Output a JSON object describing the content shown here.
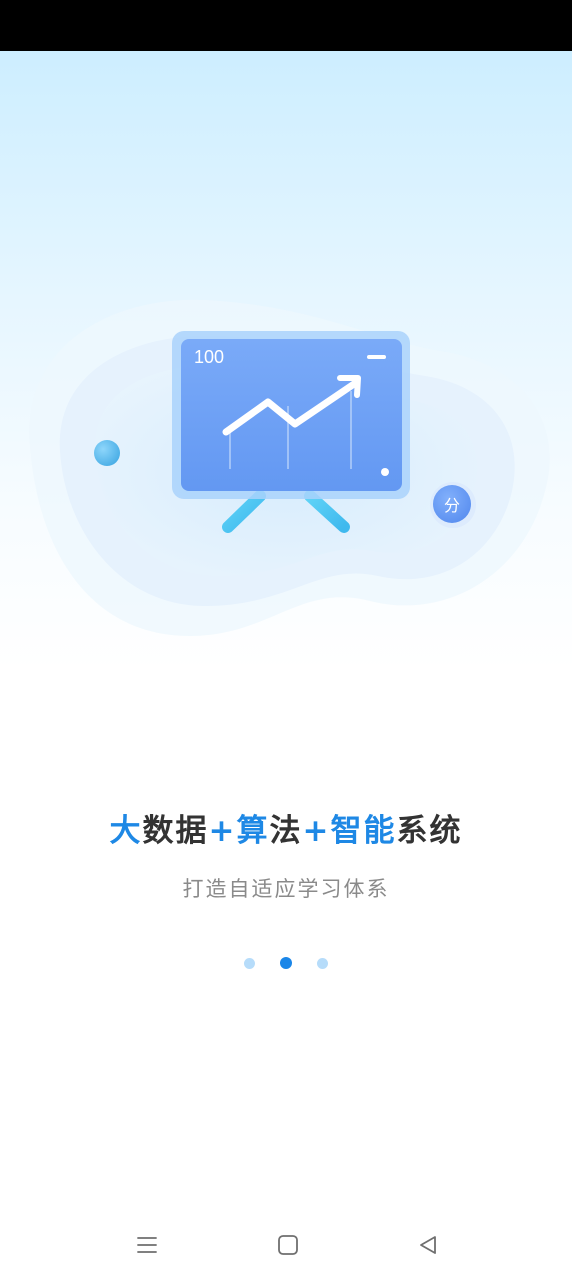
{
  "illustration": {
    "board_value": "100",
    "badge": "分"
  },
  "headline": {
    "part1": "大",
    "part2": "数据",
    "part3": "+算",
    "part4": "法",
    "part5": "+智能",
    "part6": "系统"
  },
  "subtitle": "打造自适应学习体系",
  "pagination": {
    "total": 3,
    "active_index": 1
  },
  "nav_bar": {
    "menu_icon": "menu-icon",
    "home_icon": "home-icon",
    "back_icon": "back-icon"
  },
  "colors": {
    "accent": "#1e88e5",
    "headline_text": "#333333",
    "subtitle_text": "#8a8a8a",
    "board": "#6ea3f7",
    "dot_inactive": "#b6dcfa",
    "dot_active": "#1a86e8"
  }
}
